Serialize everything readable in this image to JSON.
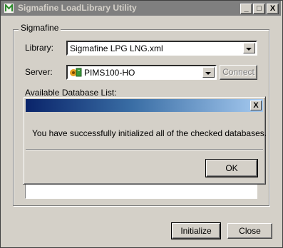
{
  "window": {
    "title": "Sigmafine LoadLibrary Utility",
    "controls": {
      "minimize": "_",
      "maximize": "□",
      "close": "X"
    }
  },
  "group": {
    "label": "Sigmafine",
    "library_label": "Library:",
    "library_value": "Sigmafine LPG LNG.xml",
    "server_label": "Server:",
    "server_value": "PIMS100-HO",
    "connect_label": "Connect",
    "db_list_label": "Available Database List:"
  },
  "footer": {
    "initialize_label": "Initialize",
    "close_label": "Close"
  },
  "message_box": {
    "title": "",
    "close_glyph": "X",
    "text": "You have successfully initialized all of the checked databases.",
    "ok_label": "OK"
  },
  "colors": {
    "dialog_bg": "#d4d0c8",
    "inactive_titlebar": "#7f7f7f",
    "active_titlebar_start": "#0a246a",
    "active_titlebar_end": "#a6caf0"
  }
}
